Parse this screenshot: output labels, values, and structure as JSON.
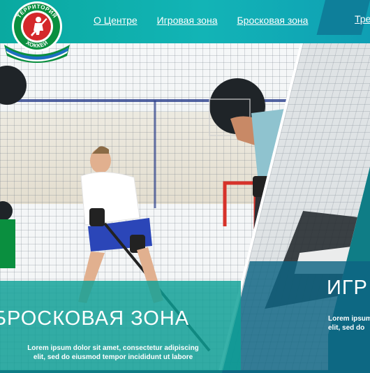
{
  "logo": {
    "top_text": "ТЕРРИТОРИЯ",
    "bottom_text": "ХОККЕЙ"
  },
  "nav": {
    "items": [
      {
        "label": "О Центре"
      },
      {
        "label": "Игровая зона"
      },
      {
        "label": "Бросковая зона"
      }
    ],
    "extra": "Тре"
  },
  "slides": {
    "left": {
      "title": "БРОСКОВАЯ ЗОНА",
      "description_line1": "Lorem ipsum dolor sit amet, consectetur adipiscing",
      "description_line2": "elit, sed do eiusmod tempor incididunt ut labore"
    },
    "right": {
      "title": "ИГР",
      "description_line1": "Lorem ipsum",
      "description_line2": "elit, sed do"
    }
  },
  "colors": {
    "header": "#12b4b6",
    "band": "#0ca096",
    "logo_green": "#0a8f3f",
    "logo_red": "#d4282a"
  }
}
